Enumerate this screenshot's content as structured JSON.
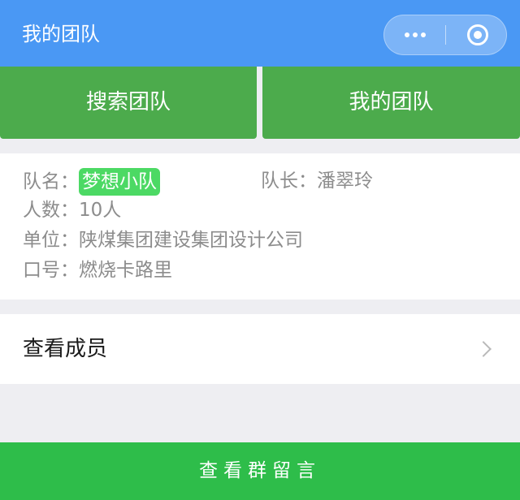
{
  "nav": {
    "title": "我的团队",
    "more_icon": "more-dots-icon",
    "close_icon": "target-close-icon",
    "background": "#4a98f4"
  },
  "tabs": {
    "search_label": "搜索团队",
    "mine_label": "我的团队",
    "color": "#4cab4c"
  },
  "team": {
    "name_label": "队名：",
    "name": "梦想小队",
    "name_badge_color": "#4cd964",
    "leader_label": "队长：",
    "leader": "潘翠玲",
    "count_label": "人数：",
    "count": "10人",
    "unit_label": "单位：",
    "unit": "陕煤集团建设集团设计公司",
    "slogan_label": "口号：",
    "slogan": "燃烧卡路里"
  },
  "members": {
    "label": "查看成员",
    "icon": "chevron-right-icon"
  },
  "footer": {
    "button_label": "查看群留言",
    "color": "#2ebd4a"
  }
}
